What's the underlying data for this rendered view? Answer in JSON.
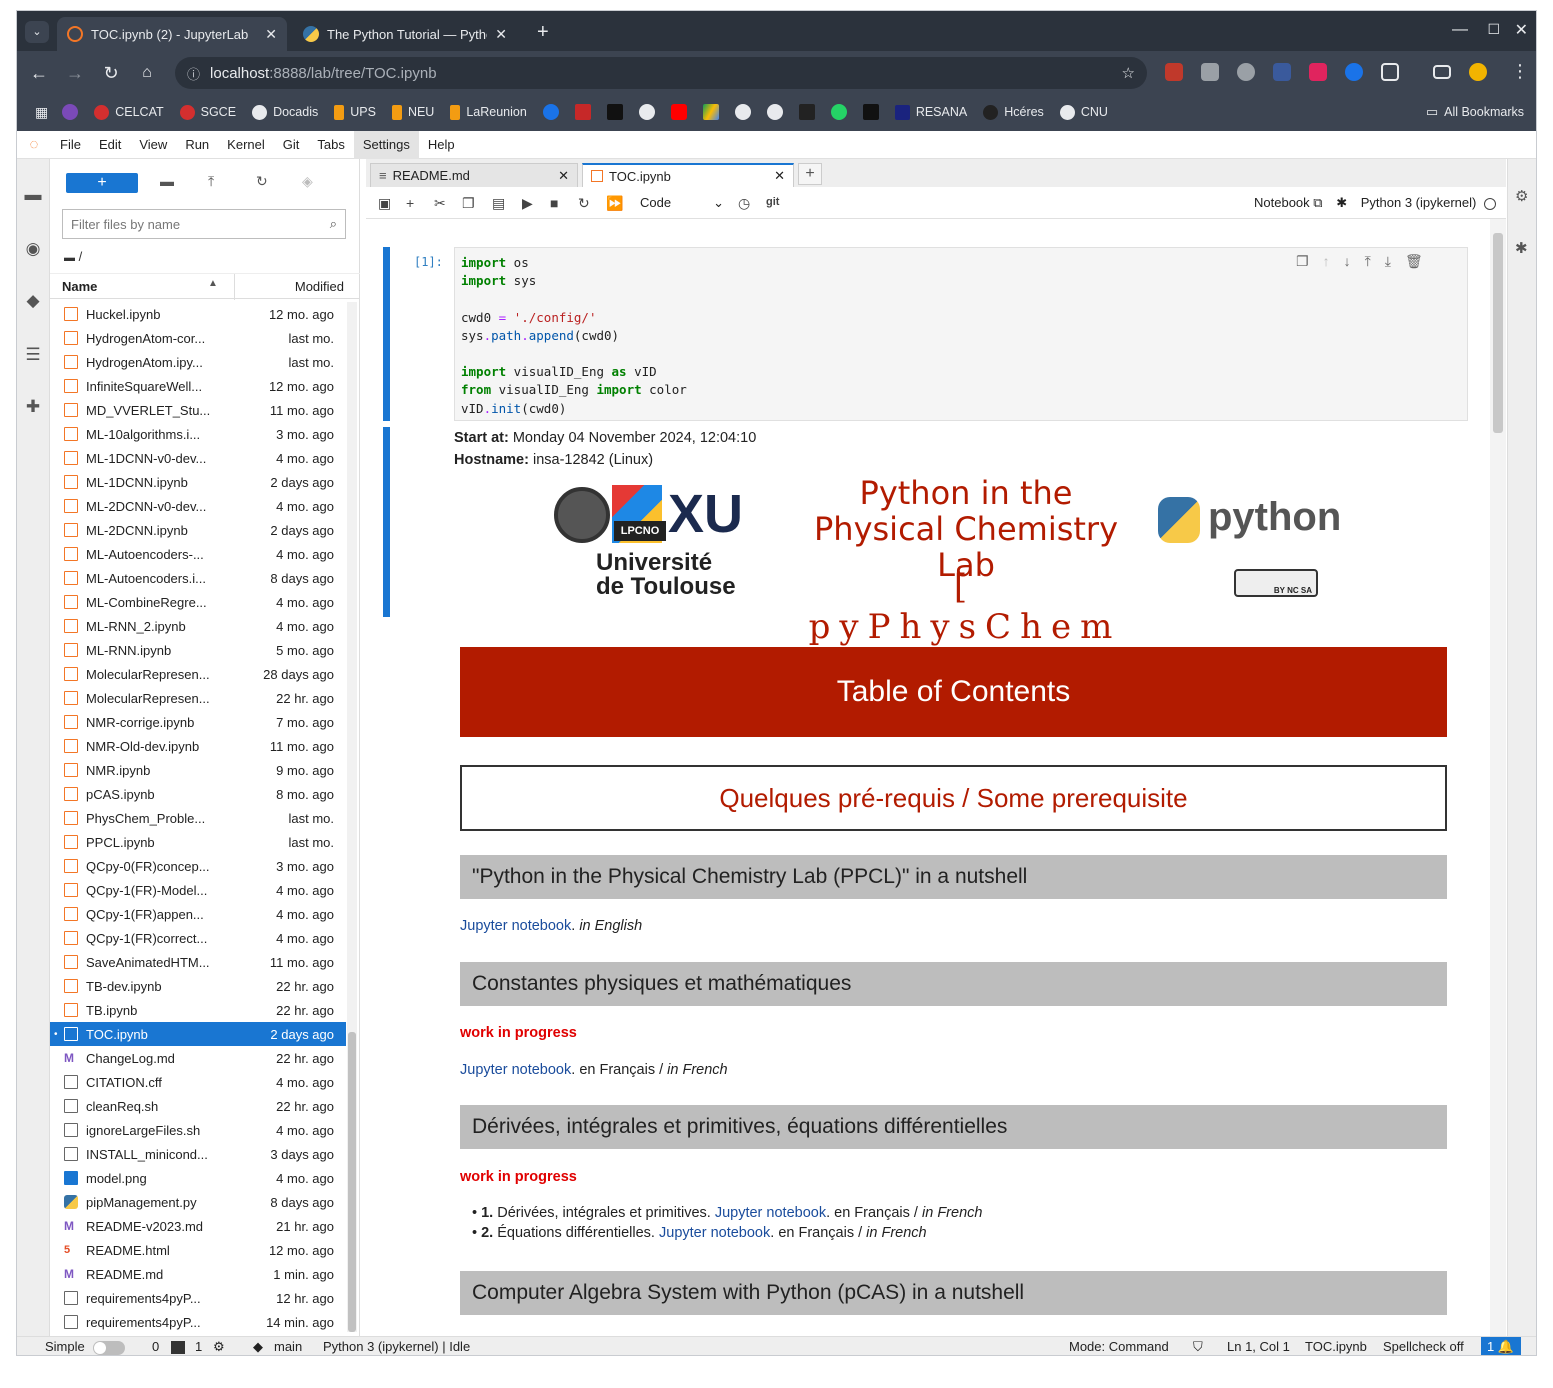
{
  "browser": {
    "tabs": [
      {
        "title": "TOC.ipynb (2) - JupyterLab",
        "active": true
      },
      {
        "title": "The Python Tutorial — Python",
        "active": false
      }
    ],
    "url_host": "localhost",
    "url_path": ":8888/lab/tree/TOC.ipynb",
    "bookmarks": [
      "CELCAT",
      "SGCE",
      "Docadis",
      "UPS",
      "NEU",
      "LaReunion",
      "RESANA",
      "Hcéres",
      "CNU"
    ],
    "all_bookmarks": "All Bookmarks"
  },
  "menu": [
    "File",
    "Edit",
    "View",
    "Run",
    "Kernel",
    "Git",
    "Tabs",
    "Settings",
    "Help"
  ],
  "filebrowser": {
    "filter_placeholder": "Filter files by name",
    "crumb": "/",
    "col_name": "Name",
    "col_modified": "Modified",
    "files": [
      {
        "name": "Huckel.ipynb",
        "mod": "12 mo. ago",
        "type": "nb"
      },
      {
        "name": "HydrogenAtom-cor...",
        "mod": "last mo.",
        "type": "nb"
      },
      {
        "name": "HydrogenAtom.ipy...",
        "mod": "last mo.",
        "type": "nb"
      },
      {
        "name": "InfiniteSquareWell...",
        "mod": "12 mo. ago",
        "type": "nb"
      },
      {
        "name": "MD_VVERLET_Stu...",
        "mod": "11 mo. ago",
        "type": "nb"
      },
      {
        "name": "ML-10algorithms.i...",
        "mod": "3 mo. ago",
        "type": "nb"
      },
      {
        "name": "ML-1DCNN-v0-dev...",
        "mod": "4 mo. ago",
        "type": "nb"
      },
      {
        "name": "ML-1DCNN.ipynb",
        "mod": "2 days ago",
        "type": "nb"
      },
      {
        "name": "ML-2DCNN-v0-dev...",
        "mod": "4 mo. ago",
        "type": "nb"
      },
      {
        "name": "ML-2DCNN.ipynb",
        "mod": "2 days ago",
        "type": "nb"
      },
      {
        "name": "ML-Autoencoders-...",
        "mod": "4 mo. ago",
        "type": "nb"
      },
      {
        "name": "ML-Autoencoders.i...",
        "mod": "8 days ago",
        "type": "nb"
      },
      {
        "name": "ML-CombineRegre...",
        "mod": "4 mo. ago",
        "type": "nb"
      },
      {
        "name": "ML-RNN_2.ipynb",
        "mod": "4 mo. ago",
        "type": "nb"
      },
      {
        "name": "ML-RNN.ipynb",
        "mod": "5 mo. ago",
        "type": "nb"
      },
      {
        "name": "MolecularRepresen...",
        "mod": "28 days ago",
        "type": "nb"
      },
      {
        "name": "MolecularRepresen...",
        "mod": "22 hr. ago",
        "type": "nb"
      },
      {
        "name": "NMR-corrige.ipynb",
        "mod": "7 mo. ago",
        "type": "nb"
      },
      {
        "name": "NMR-Old-dev.ipynb",
        "mod": "11 mo. ago",
        "type": "nb"
      },
      {
        "name": "NMR.ipynb",
        "mod": "9 mo. ago",
        "type": "nb"
      },
      {
        "name": "pCAS.ipynb",
        "mod": "8 mo. ago",
        "type": "nb"
      },
      {
        "name": "PhysChem_Proble...",
        "mod": "last mo.",
        "type": "nb"
      },
      {
        "name": "PPCL.ipynb",
        "mod": "last mo.",
        "type": "nb"
      },
      {
        "name": "QCpy-0(FR)concep...",
        "mod": "3 mo. ago",
        "type": "nb"
      },
      {
        "name": "QCpy-1(FR)-Model...",
        "mod": "4 mo. ago",
        "type": "nb"
      },
      {
        "name": "QCpy-1(FR)appen...",
        "mod": "4 mo. ago",
        "type": "nb"
      },
      {
        "name": "QCpy-1(FR)correct...",
        "mod": "4 mo. ago",
        "type": "nb"
      },
      {
        "name": "SaveAnimatedHTM...",
        "mod": "11 mo. ago",
        "type": "nb"
      },
      {
        "name": "TB-dev.ipynb",
        "mod": "22 hr. ago",
        "type": "nb"
      },
      {
        "name": "TB.ipynb",
        "mod": "22 hr. ago",
        "type": "nb"
      },
      {
        "name": "TOC.ipynb",
        "mod": "2 days ago",
        "type": "nb",
        "selected": true
      },
      {
        "name": "ChangeLog.md",
        "mod": "22 hr. ago",
        "type": "md"
      },
      {
        "name": "CITATION.cff",
        "mod": "4 mo. ago",
        "type": "doc"
      },
      {
        "name": "cleanReq.sh",
        "mod": "22 hr. ago",
        "type": "doc"
      },
      {
        "name": "ignoreLargeFiles.sh",
        "mod": "4 mo. ago",
        "type": "doc"
      },
      {
        "name": "INSTALL_minicond...",
        "mod": "3 days ago",
        "type": "doc"
      },
      {
        "name": "model.png",
        "mod": "4 mo. ago",
        "type": "img"
      },
      {
        "name": "pipManagement.py",
        "mod": "8 days ago",
        "type": "py"
      },
      {
        "name": "README-v2023.md",
        "mod": "21 hr. ago",
        "type": "md"
      },
      {
        "name": "README.html",
        "mod": "12 mo. ago",
        "type": "html"
      },
      {
        "name": "README.md",
        "mod": "1 min. ago",
        "type": "md"
      },
      {
        "name": "requirements4pyP...",
        "mod": "12 hr. ago",
        "type": "doc"
      },
      {
        "name": "requirements4pyP...",
        "mod": "14 min. ago",
        "type": "doc"
      }
    ]
  },
  "doc_tabs": [
    {
      "title": "README.md",
      "active": false
    },
    {
      "title": "TOC.ipynb",
      "active": true
    }
  ],
  "nb_toolbar": {
    "cell_type": "Code",
    "git": "git",
    "notebook_label": "Notebook",
    "kernel": "Python 3 (ipykernel)"
  },
  "cell": {
    "prompt": "[1]:",
    "start_label": "Start at:",
    "start_value": "Monday 04 November 2024, 12:04:10",
    "host_label": "Hostname:",
    "host_value": "insa-12842 (Linux)"
  },
  "banner": {
    "univ1": "Université",
    "univ2": "de Toulouse",
    "lpcno": "LPCNO",
    "title1": "Python in the",
    "title2": "Physical Chemistry Lab",
    "short": "[ pyPhysChem ]",
    "python": "python",
    "cc": "BY NC SA"
  },
  "toc": {
    "title": "Table of Contents",
    "prereq": "Quelques pré-requis / Some prerequisite",
    "s1": "\"Python in the Physical Chemistry Lab (PPCL)\" in a nutshell",
    "s1_link": "Jupyter notebook",
    "s1_lang": "in English",
    "s2": "Constantes physiques et mathématiques",
    "wip": "work in progress",
    "s2_link": "Jupyter notebook",
    "fr": "en Français /",
    "in_french": "in French",
    "s3": "Dérivées, intégrales et primitives, équations différentielles",
    "b1_num": "1.",
    "b1_text": "Dérivées, intégrales et primitives.",
    "b2_num": "2.",
    "b2_text": "Équations différentielles.",
    "s4": "Computer Algebra System with Python (pCAS) in a nutshell"
  },
  "status": {
    "simple": "Simple",
    "n0": "0",
    "n1": "1",
    "branch": "main",
    "kernel_state": "Python 3 (ipykernel) | Idle",
    "mode": "Mode: Command",
    "pos": "Ln 1, Col 1",
    "file": "TOC.ipynb",
    "spell": "Spellcheck off",
    "notif": "1"
  },
  "colors": {
    "accent": "#1976d2",
    "toc_red": "#b21b00",
    "section_gray": "#bdbdbd",
    "wip_red": "#e00000"
  }
}
